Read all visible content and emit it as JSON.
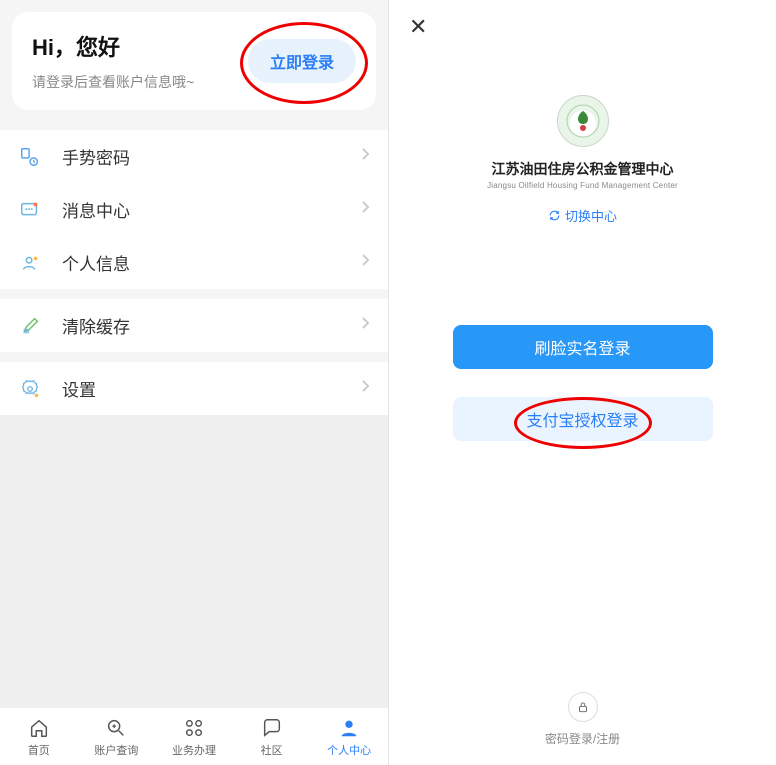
{
  "left": {
    "greeting_title": "Hi，您好",
    "greeting_subtitle": "请登录后查看账户信息哦~",
    "login_button": "立即登录",
    "menu": {
      "gesture": "手势密码",
      "messages": "消息中心",
      "profile": "个人信息",
      "cache": "清除缓存",
      "settings": "设置"
    },
    "tabs": {
      "home": "首页",
      "account": "账户查询",
      "business": "业务办理",
      "community": "社区",
      "personal": "个人中心"
    }
  },
  "right": {
    "org_name_cn": "江苏油田住房公积金管理中心",
    "org_name_en": "Jiangsu Oilfield Housing Fund Management Center",
    "switch_center": "切换中心",
    "face_login": "刷脸实名登录",
    "alipay_login": "支付宝授权登录",
    "password_login": "密码登录/注册"
  }
}
